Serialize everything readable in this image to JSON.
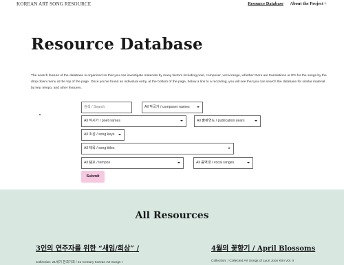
{
  "header": {
    "site_title": "KOREAN ART SONG RESOURCE",
    "nav": {
      "database": "Resource Database",
      "about": "About the Project",
      "plus": "+"
    }
  },
  "main": {
    "title": "Resource Database",
    "intro": "The search feature of the database is organized so that you can investigate materials by many factors including poet, composer, vocal range, whether there are translations or IPA for the songs by the drop down menu at the top of the page. Once you've found an individual entry, at the bottom of the page, below a link to a recording, you will see that you can search the database for similar material by key, tempo, and other features."
  },
  "filters": {
    "search_placeholder": "검색 / Search",
    "composer": "All 작곡가 / composer names",
    "poet": "All 작시가 / poet names",
    "pub_year": "All 출판연도 / publication years",
    "key": "All 조성 / song keys",
    "song_title": "All 제목 / song titles",
    "tempo": "All 템포 / tempos",
    "vocal_range": "All 음역대 / vocal ranges",
    "submit": "Submit"
  },
  "resources": {
    "heading": "All Resources",
    "items": [
      {
        "title": "3인의 연주자를 위한 “새임/희상” /",
        "collection": "Collection: 21세기 한국가곡 / 21 Century Korean Art Songs I"
      },
      {
        "title": "4월의 꽃향기 / April Blossoms",
        "collection": "Collection: / Collected Art Songs of Lyun Joon Kim Vol. II"
      }
    ]
  },
  "colors": {
    "accent_pink": "#f7c8e2",
    "section_bg": "#d8e8e1"
  }
}
